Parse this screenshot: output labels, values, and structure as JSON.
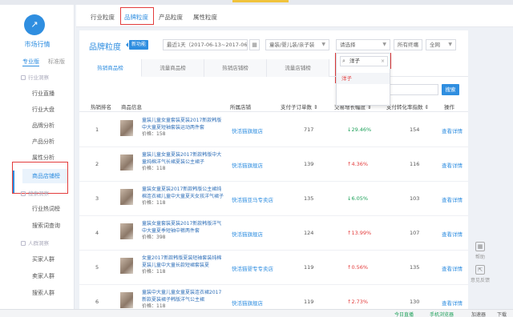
{
  "sidebar": {
    "logo_glyph": "↗",
    "brand": "市场行情",
    "versions": [
      "专业版",
      "标准版"
    ],
    "groups": [
      {
        "label": "行业洞察",
        "icon": "box-icon"
      },
      {
        "label": "搜索洞察",
        "icon": "box-icon"
      },
      {
        "label": "人群洞察",
        "icon": "box-icon"
      }
    ],
    "items": [
      "行业直播",
      "行业大盘",
      "品牌分析",
      "产品分析",
      "属性分析",
      "商品店铺榜",
      "行业热词榜",
      "搜索词查询",
      "买家人群",
      "卖家人群",
      "搜索人群"
    ]
  },
  "tabs": [
    "行业粒度",
    "品牌粒度",
    "产品粒度",
    "属性粒度"
  ],
  "panel": {
    "title": "品牌粒度",
    "badge": "新功能",
    "date_range": "最近1天（2017-06-13~2017-06-13）",
    "date_icon": "▦",
    "category": "童装/婴儿装/亲子装",
    "brand_select": "请选择",
    "terminal": "所有终端",
    "channel": "全网",
    "dropdown_search": "洋子",
    "dropdown_option": "洋子",
    "subtabs": [
      "热销商品榜",
      "流量商品榜",
      "热销店铺榜",
      "流量店铺榜"
    ],
    "search_placeholder": "请输入商品关键词",
    "search_button": "搜索",
    "headers": [
      "热销排名",
      "商品信息",
      "所属店铺",
      "支付子订单数 ⇕",
      "交易增长幅度 ⇕",
      "支付转化率指数 ⇕",
      "操作"
    ],
    "rows": [
      {
        "rank": "1",
        "title": "童装儿童女童套装夏装2017新款韩版中大童夏短袖套装运动两件套",
        "price": "价格：158",
        "shop": "快活猫旗舰店",
        "orders": "717",
        "growth": "↓29.46%",
        "dir": "up",
        "conv": "154",
        "action": "查看详情"
      },
      {
        "rank": "2",
        "title": "童装儿童女童夏装2017新款韩版中大童纯棉洋气长裙夏装公主裙子",
        "price": "价格：118",
        "shop": "快活猫旗舰店",
        "orders": "139",
        "growth": "↑4.36%",
        "dir": "down",
        "conv": "116",
        "action": "查看详情"
      },
      {
        "rank": "3",
        "title": "童装女童夏装2017新款韩版公主裙纯棉连衣裙儿童中大童夏天女孩洋气裙子",
        "price": "价格：118",
        "shop": "快活猫亚马专卖店",
        "orders": "135",
        "growth": "↓6.05%",
        "dir": "up",
        "conv": "103",
        "action": "查看详情"
      },
      {
        "rank": "4",
        "title": "童装女童套装夏装2017新款韩版洋气中大童夏季短袖中裤两件套",
        "price": "价格：398",
        "shop": "快活猫旗舰店",
        "orders": "124",
        "growth": "↑13.99%",
        "dir": "down",
        "conv": "107",
        "action": "查看详情"
      },
      {
        "rank": "5",
        "title": "女童2017新款韩版夏装短袖套装纯棉夏装儿童中大童长款短裙套装夏",
        "price": "价格：118",
        "shop": "快活猫婴专专卖店",
        "orders": "119",
        "growth": "↑0.56%",
        "dir": "down",
        "conv": "135",
        "action": "查看详情"
      },
      {
        "rank": "6",
        "title": "童装中大童儿童女童夏装连衣裙2017新款夏装裙子韩版洋气公主裙",
        "price": "价格：118",
        "shop": "快活猫旗舰店",
        "orders": "119",
        "growth": "↑2.73%",
        "dir": "down",
        "conv": "130",
        "action": "查看详情"
      }
    ]
  },
  "rightbar": {
    "labels": [
      "帮助",
      "意见反馈"
    ],
    "icons": [
      "▦",
      "⇱"
    ]
  },
  "statusbar": {
    "live": "今日直播",
    "browser": "手机浏览器",
    "speed": "加速器",
    "download": "下载"
  },
  "colors": {
    "accent": "#2f8ee0",
    "highlight": "#e33c3c",
    "up": "#1ea15a"
  }
}
